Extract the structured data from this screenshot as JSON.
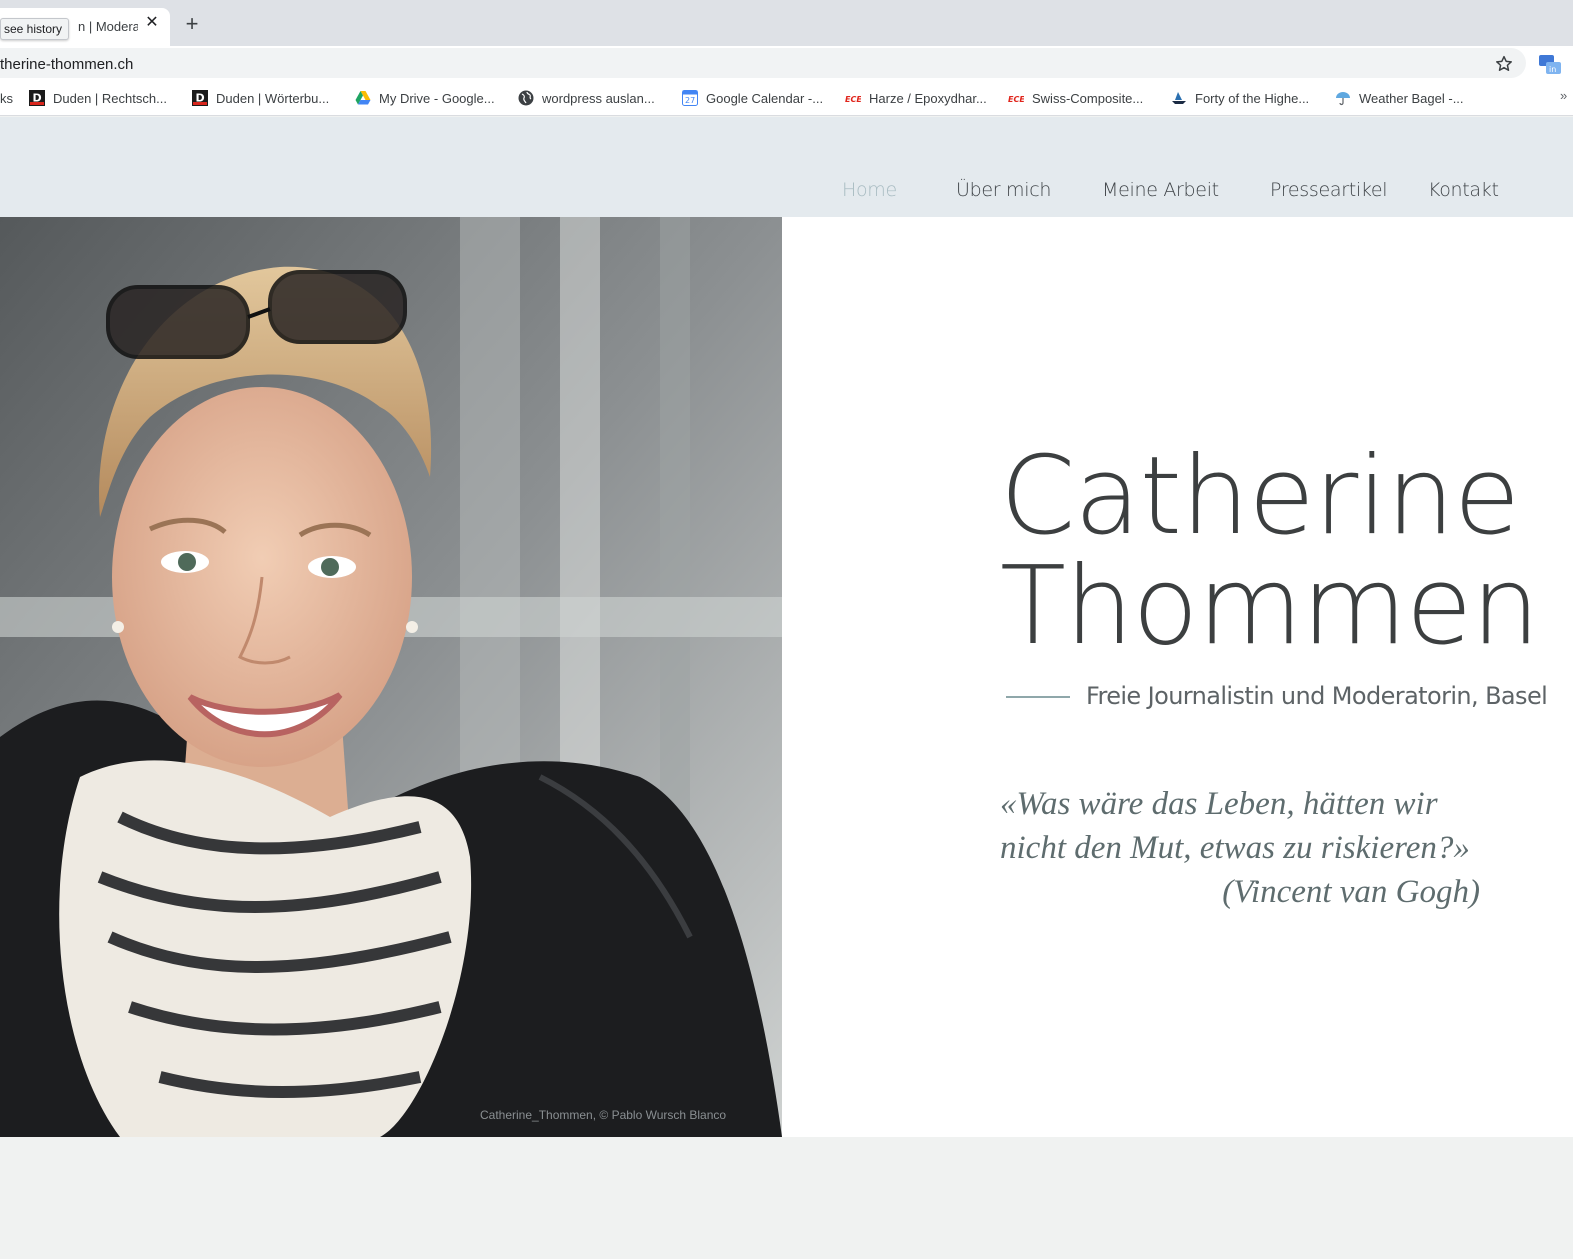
{
  "browser": {
    "tab": {
      "title": "n | Moderat",
      "tooltip": "see history"
    },
    "url": "therine-thommen.ch",
    "bookmarks": [
      {
        "label": "ks",
        "icon": "none"
      },
      {
        "label": "Duden | Rechtsch...",
        "icon": "duden-icon"
      },
      {
        "label": "Duden | Wörterbu...",
        "icon": "duden-icon"
      },
      {
        "label": "My Drive - Google...",
        "icon": "google-drive-icon"
      },
      {
        "label": "wordpress auslan...",
        "icon": "globe-icon"
      },
      {
        "label": "Google Calendar -...",
        "icon": "google-calendar-icon"
      },
      {
        "label": "Harze / Epoxydhar...",
        "icon": "ece-icon"
      },
      {
        "label": "Swiss-Composite...",
        "icon": "ece-icon"
      },
      {
        "label": "Forty of the Highe...",
        "icon": "ship-icon"
      },
      {
        "label": "Weather Bagel -...",
        "icon": "umbrella-icon"
      }
    ],
    "more": "»"
  },
  "site": {
    "nav": [
      {
        "label": "Home",
        "active": true
      },
      {
        "label": "Über mich"
      },
      {
        "label": "Meine Arbeit"
      },
      {
        "label": "Presseartikel"
      },
      {
        "label": "Kontakt"
      }
    ],
    "name_first": "Catherine",
    "name_last": "Thommen",
    "subtitle": "Freie Journalistin und Moderatorin, Basel",
    "quote_line1": "«Was wäre das Leben, hätten wir",
    "quote_line2": "nicht den Mut, etwas zu riskieren?»",
    "quote_author": "(Vincent van Gogh)",
    "photo_credit": "Catherine_Thommen, © Pablo Wursch Blanco"
  }
}
